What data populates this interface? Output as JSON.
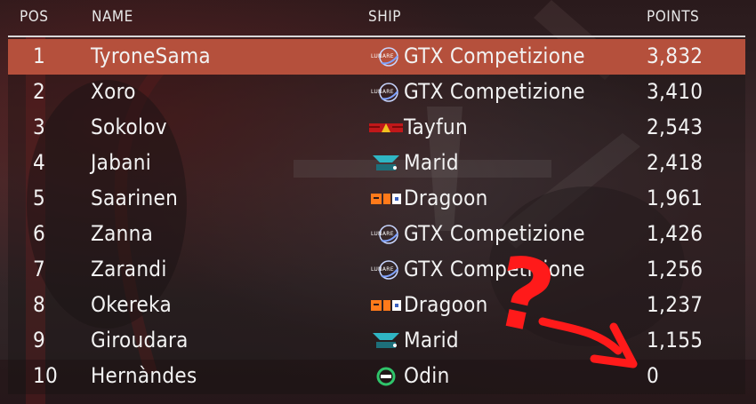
{
  "columns": {
    "pos": "POS",
    "name": "NAME",
    "ship": "SHIP",
    "points": "POINTS"
  },
  "rows": [
    {
      "pos": "1",
      "name": "TyroneSama",
      "ship": "GTX Competizione",
      "ship_logo": "lunare-logo-icon",
      "points": "3,832",
      "highlighted": true
    },
    {
      "pos": "2",
      "name": "Xoro",
      "ship": "GTX Competizione",
      "ship_logo": "lunare-logo-icon",
      "points": "3,410"
    },
    {
      "pos": "3",
      "name": "Sokolov",
      "ship": "Tayfun",
      "ship_logo": "tayfun-logo-icon",
      "points": "2,543"
    },
    {
      "pos": "4",
      "name": "Jabani",
      "ship": "Marid",
      "ship_logo": "marid-logo-icon",
      "points": "2,418"
    },
    {
      "pos": "5",
      "name": "Saarinen",
      "ship": "Dragoon",
      "ship_logo": "dragoon-logo-icon",
      "points": "1,961"
    },
    {
      "pos": "6",
      "name": "Zanna",
      "ship": "GTX Competizione",
      "ship_logo": "lunare-logo-icon",
      "points": "1,426"
    },
    {
      "pos": "7",
      "name": "Zarandi",
      "ship": "GTX Competizione",
      "ship_logo": "lunare-logo-icon",
      "points": "1,256"
    },
    {
      "pos": "8",
      "name": "Okereka",
      "ship": "Dragoon",
      "ship_logo": "dragoon-logo-icon",
      "points": "1,237"
    },
    {
      "pos": "9",
      "name": "Giroudara",
      "ship": "Marid",
      "ship_logo": "marid-logo-icon",
      "points": "1,155"
    },
    {
      "pos": "10",
      "name": "Hernàndes",
      "ship": "Odin",
      "ship_logo": "odin-logo-icon",
      "points": "0"
    }
  ],
  "colors": {
    "highlight": "#b5503c",
    "annotation": "#ff1a1a"
  },
  "annotation": {
    "glyph": "?"
  }
}
